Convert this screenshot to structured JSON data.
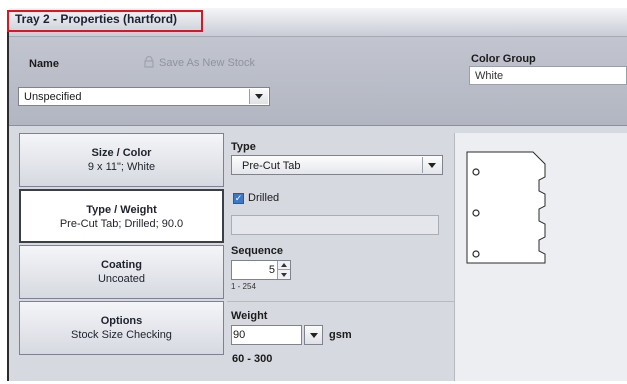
{
  "window": {
    "title": "Tray 2 - Properties (hartford)"
  },
  "top": {
    "name_label": "Name",
    "save_as_new_stock": "Save As New Stock",
    "name_value": "Unspecified",
    "color_group_label": "Color Group",
    "color_group_value": "White"
  },
  "tabs": [
    {
      "title": "Size / Color",
      "subtitle": "9 x 11\"; White"
    },
    {
      "title": "Type / Weight",
      "subtitle": "Pre-Cut Tab; Drilled; 90.0"
    },
    {
      "title": "Coating",
      "subtitle": "Uncoated"
    },
    {
      "title": "Options",
      "subtitle": "Stock Size Checking"
    }
  ],
  "form": {
    "type_label": "Type",
    "type_value": "Pre-Cut Tab",
    "drilled_label": "Drilled",
    "drilled_checked": true,
    "sequence_label": "Sequence",
    "sequence_value": "5",
    "sequence_range": "1 - 254",
    "weight_label": "Weight",
    "weight_value": "90",
    "weight_unit": "gsm",
    "weight_range": "60 - 300"
  },
  "colors": {
    "active_tab_border": "#3b3f47",
    "title_highlight": "#e0141e",
    "checkbox": "#3b78c8"
  }
}
